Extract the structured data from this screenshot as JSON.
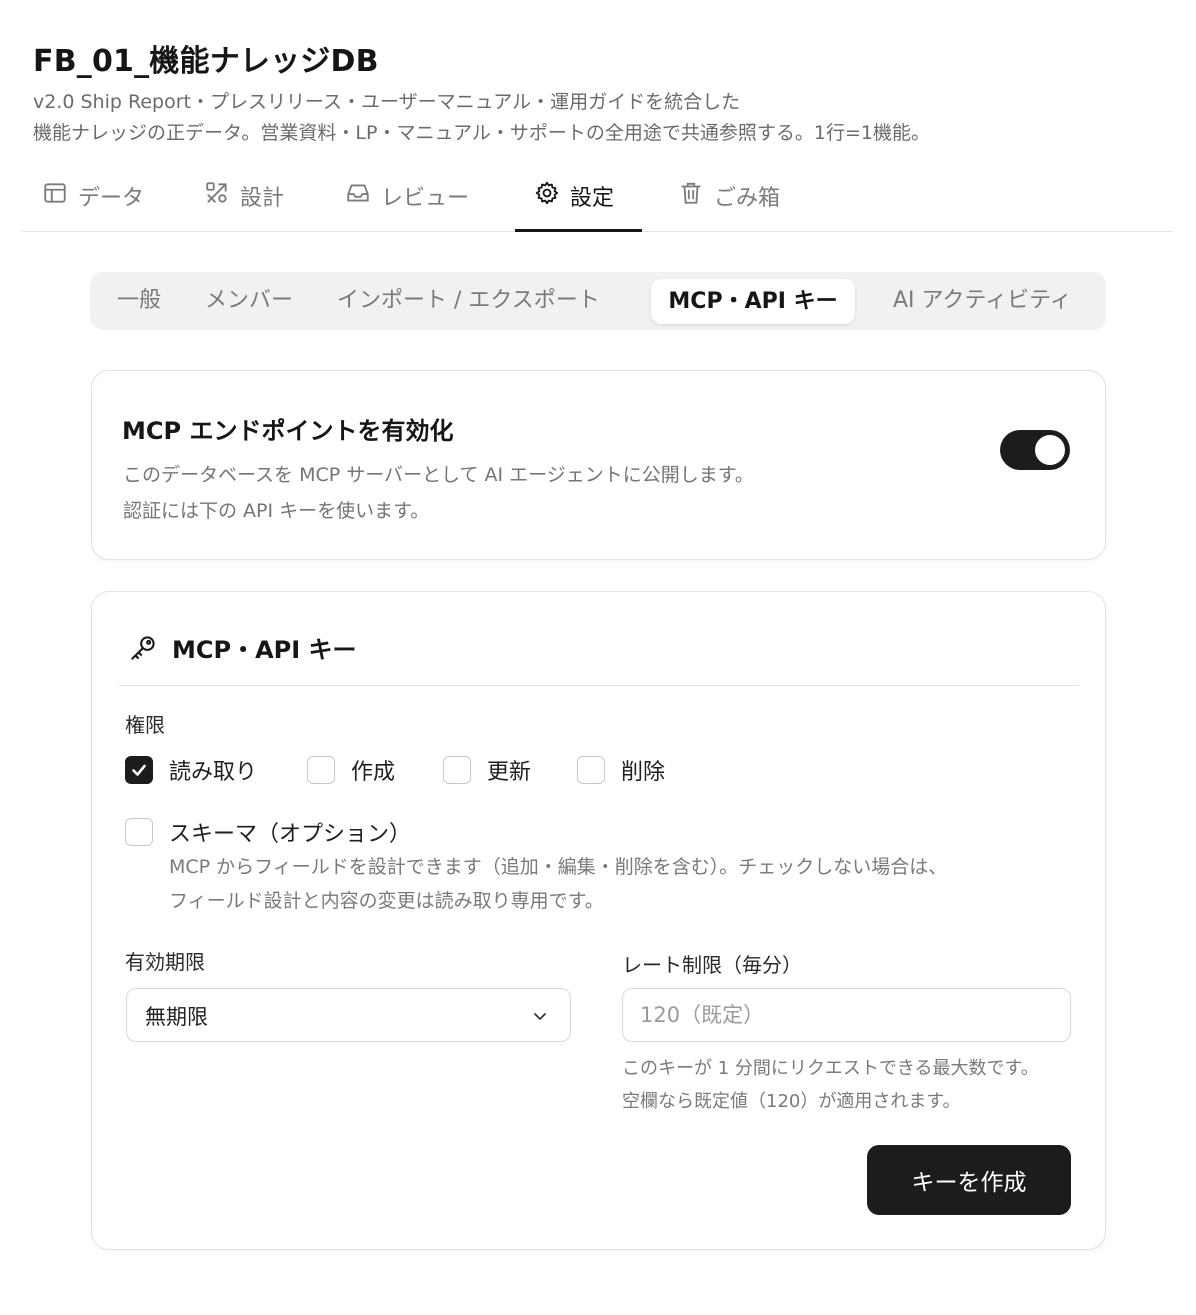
{
  "header": {
    "title": "FB_01_機能ナレッジDB",
    "desc_line1": "v2.0 Ship Report・プレスリリース・ユーザーマニュアル・運用ガイドを統合した",
    "desc_line2": "機能ナレッジの正データ。営業資料・LP・マニュアル・サポートの全用途で共通参照する。1行=1機能。"
  },
  "main_tabs": [
    {
      "label": "データ",
      "icon": "table-icon"
    },
    {
      "label": "設計",
      "icon": "tools-icon"
    },
    {
      "label": "レビュー",
      "icon": "inbox-icon"
    },
    {
      "label": "設定",
      "icon": "gear-icon",
      "active": true
    },
    {
      "label": "ごみ箱",
      "icon": "trash-icon"
    }
  ],
  "sub_tabs": [
    {
      "label": "一般"
    },
    {
      "label": "メンバー"
    },
    {
      "label": "インポート / エクスポート"
    },
    {
      "label": "MCP・API キー",
      "active": true
    },
    {
      "label": "AI アクティビティ"
    }
  ],
  "mcp_endpoint": {
    "title": "MCP エンドポイントを有効化",
    "desc_line1": "このデータベースを MCP サーバーとして AI エージェントに公開します。",
    "desc_line2": "認証には下の API キーを使います。",
    "enabled": true
  },
  "api_keys": {
    "title": "MCP・API キー",
    "icon": "key-icon",
    "permissions_label": "権限",
    "permissions": [
      {
        "label": "読み取り",
        "checked": true
      },
      {
        "label": "作成",
        "checked": false
      },
      {
        "label": "更新",
        "checked": false
      },
      {
        "label": "削除",
        "checked": false
      }
    ],
    "schema": {
      "label": "スキーマ（オプション）",
      "checked": false,
      "desc_line1": "MCP からフィールドを設計できます（追加・編集・削除を含む）。チェックしない場合は、",
      "desc_line2": "フィールド設計と内容の変更は読み取り専用です。"
    },
    "expiry_label": "有効期限",
    "expiry_value": "無期限",
    "rate_label": "レート制限（毎分）",
    "rate_placeholder": "120（既定）",
    "rate_help_line1": "このキーが 1 分間にリクエストできる最大数です。",
    "rate_help_line2": "空欄なら既定値（120）が適用されます。",
    "create_button": "キーを作成"
  },
  "colors": {
    "accent": "#1c1c1c",
    "muted_text": "#7a7a7a",
    "border": "#e2e2e2"
  }
}
